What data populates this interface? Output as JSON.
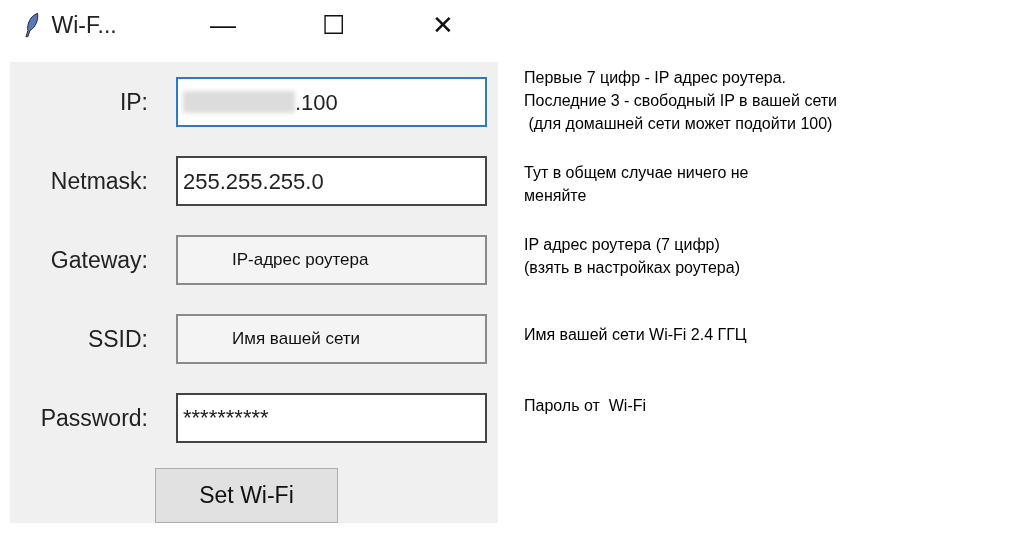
{
  "window": {
    "title": "Wi-F...",
    "controls": [
      "—",
      "☐",
      "✕"
    ]
  },
  "fields": [
    {
      "label": "IP:",
      "value": ".100",
      "kind": "entry",
      "focused": true,
      "redacted": true
    },
    {
      "label": "Netmask:",
      "value": "255.255.255.0",
      "kind": "entry",
      "focused": false
    },
    {
      "label": "Gateway:",
      "value": "IP-адрес роутера",
      "kind": "overlay",
      "focused": false
    },
    {
      "label": "SSID:",
      "value": "Имя вашей сети",
      "kind": "overlay",
      "focused": false
    },
    {
      "label": "Password:",
      "value": "**********",
      "kind": "entry",
      "focused": false
    }
  ],
  "button": "Set Wi-Fi",
  "notes": [
    [
      "Первые 7 цифр - IP адрес роутера.",
      "Последние 3 - свободный IP в вашей сети",
      " (для домашней сети может подойти 100)"
    ],
    [
      "Тут в общем случае ничего не",
      "меняйте"
    ],
    [
      "IP адрес роутера (7 цифр)",
      "(взять в настройках роутера)"
    ],
    [
      "Имя вашей сети Wi-Fi 2.4 ГГЦ"
    ],
    [
      "Пароль от  Wi-Fi"
    ]
  ]
}
